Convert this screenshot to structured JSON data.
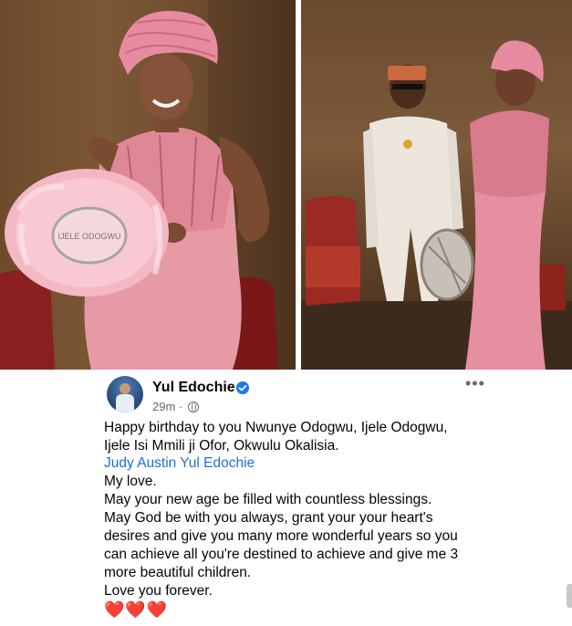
{
  "post": {
    "author": "Yul Edochie",
    "time": "29m",
    "separator": "·",
    "more_label": "•••",
    "lines": [
      "Happy birthday to you Nwunye Odogwu, Ijele Odogwu,",
      "Ijele Isi Mmili ji Ofor, Okwulu Okalisia.",
      "Judy Austin Yul Edochie",
      "My love.",
      "May your new age be filled with countless blessings.",
      "May God be with you always, grant your your heart's",
      "desires and give you many more wonderful years so you",
      "can achieve all you're destined to achieve and give me 3",
      "more beautiful children.",
      "Love you forever."
    ],
    "hearts": "❤️❤️❤️"
  },
  "photos": {
    "fan_text": "IJELE ODOGWU"
  },
  "icons": {
    "verified": "verified-badge-icon",
    "audience": "globe-icon",
    "more": "more-options-icon"
  },
  "colors": {
    "mention": "#216fdb",
    "verified": "#1877f2",
    "meta": "#65676b",
    "dress_pink": "#e69aa6"
  }
}
